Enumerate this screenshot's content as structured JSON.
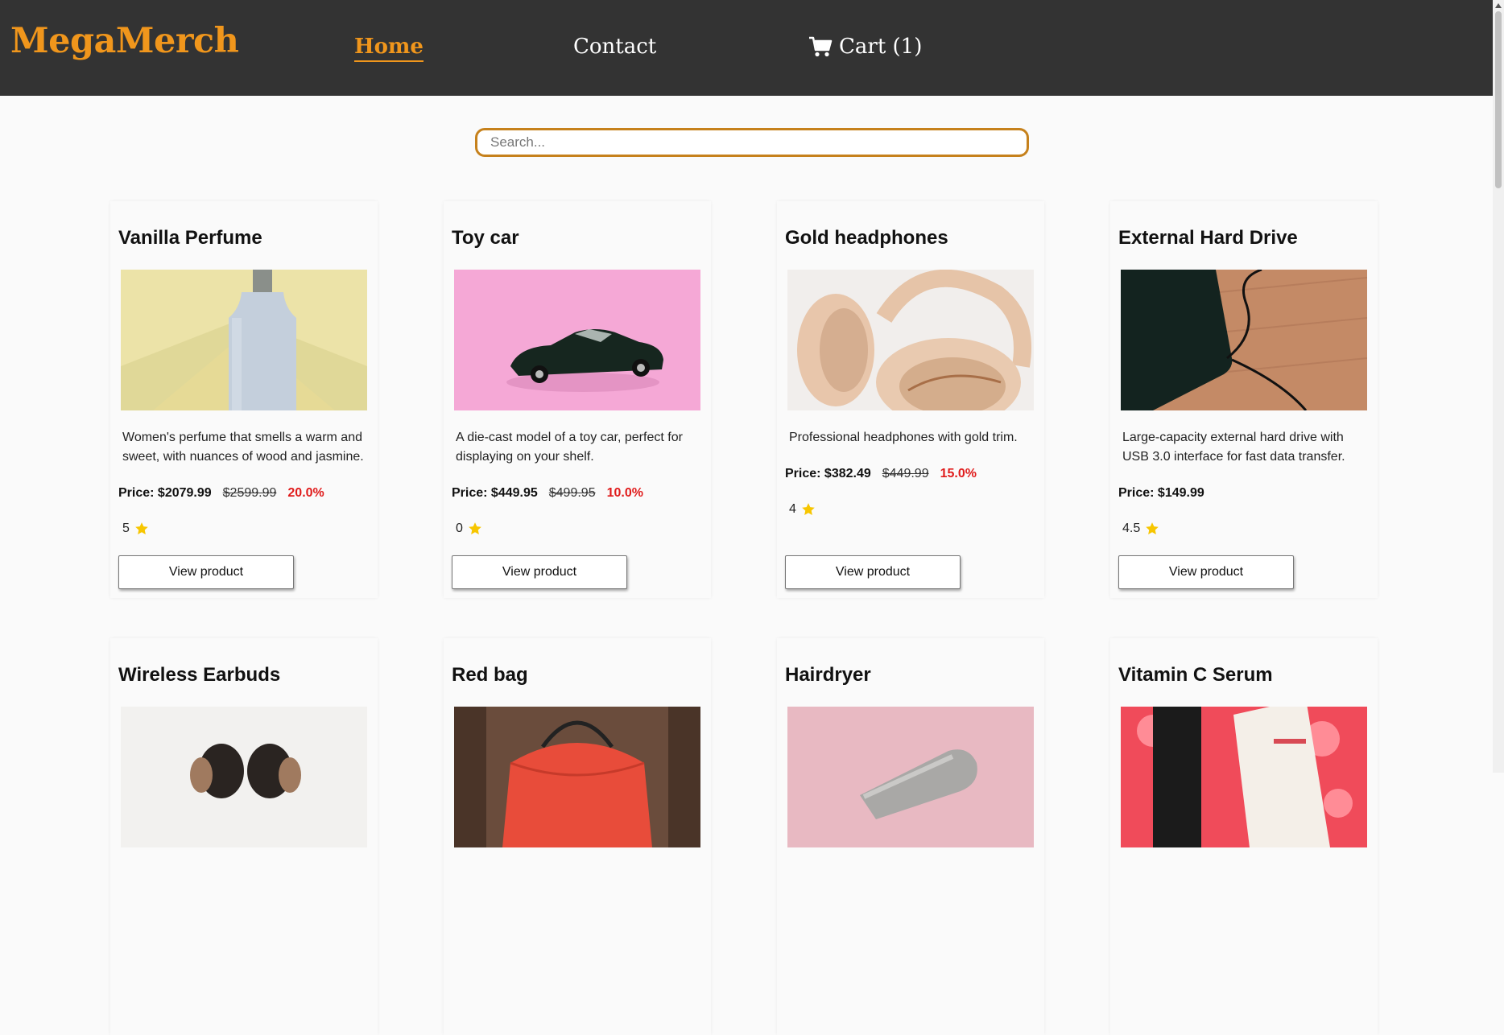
{
  "brand": "MegaMerch",
  "nav": {
    "home": "Home",
    "contact": "Contact",
    "cart": "Cart (1)"
  },
  "search": {
    "placeholder": "Search..."
  },
  "view_label": "View product",
  "colors": {
    "accent": "#f0961c",
    "navbar": "#333333",
    "discount": "#e01b1b",
    "star": "#f7c600"
  },
  "products": [
    {
      "name": "Vanilla Perfume",
      "description": "Women's perfume that smells a warm and sweet, with nuances of wood and jasmine.",
      "price": "Price: $2079.99",
      "old_price": "$2599.99",
      "discount": "20.0%",
      "rating": "5"
    },
    {
      "name": "Toy car",
      "description": "A die-cast model of a toy car, perfect for displaying on your shelf.",
      "price": "Price: $449.95",
      "old_price": "$499.95",
      "discount": "10.0%",
      "rating": "0"
    },
    {
      "name": "Gold headphones",
      "description": "Professional headphones with gold trim.",
      "price": "Price: $382.49",
      "old_price": "$449.99",
      "discount": "15.0%",
      "rating": "4"
    },
    {
      "name": "External Hard Drive",
      "description": "Large-capacity external hard drive with USB 3.0 interface for fast data transfer.",
      "price": "Price: $149.99",
      "rating": "4.5"
    },
    {
      "name": "Wireless Earbuds"
    },
    {
      "name": "Red bag"
    },
    {
      "name": "Hairdryer"
    },
    {
      "name": "Vitamin C Serum"
    }
  ]
}
